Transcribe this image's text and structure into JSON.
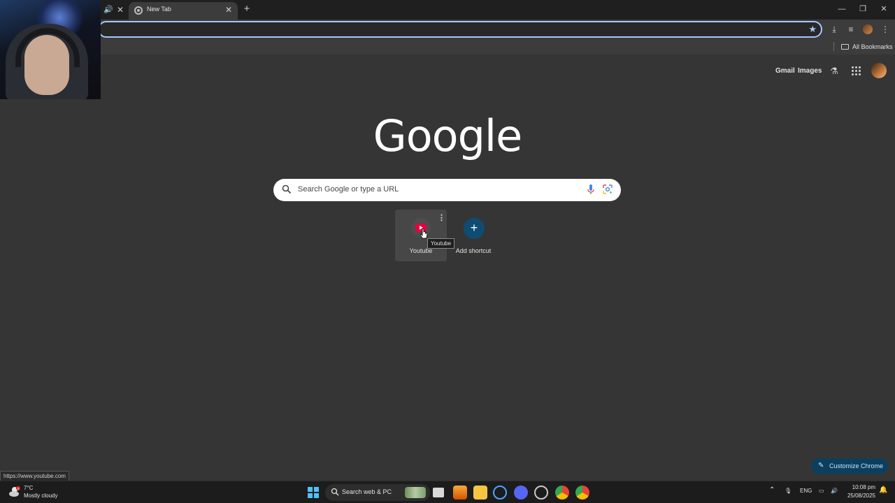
{
  "browser": {
    "tabs": [
      {
        "label": "New Tab",
        "active": true
      }
    ],
    "new_tab_symbol": "+",
    "bookmarks": {
      "all_bookmarks_label": "All Bookmarks"
    },
    "status_url": "https://www.youtube.com"
  },
  "ntp": {
    "header": {
      "gmail_label": "Gmail",
      "images_label": "Images"
    },
    "logo_text": "Google",
    "search": {
      "placeholder": "Search Google or type a URL"
    },
    "shortcuts": [
      {
        "label": "Youtube",
        "tooltip": "Youtube"
      },
      {
        "label": "Add shortcut"
      }
    ],
    "customize_label": "Customize Chrome"
  },
  "taskbar": {
    "weather": {
      "temp": "7°C",
      "condition": "Mostly cloudy",
      "badge": "2"
    },
    "search_label": "Search web & PC",
    "tray": {
      "language": "ENG",
      "time": "10:08 pm",
      "date": "25/08/2025"
    }
  },
  "colors": {
    "page_bg": "#353535",
    "accent_blue": "#a8c7fa",
    "youtube_red": "#e8003d",
    "customize_bg": "#0c3f5e"
  }
}
